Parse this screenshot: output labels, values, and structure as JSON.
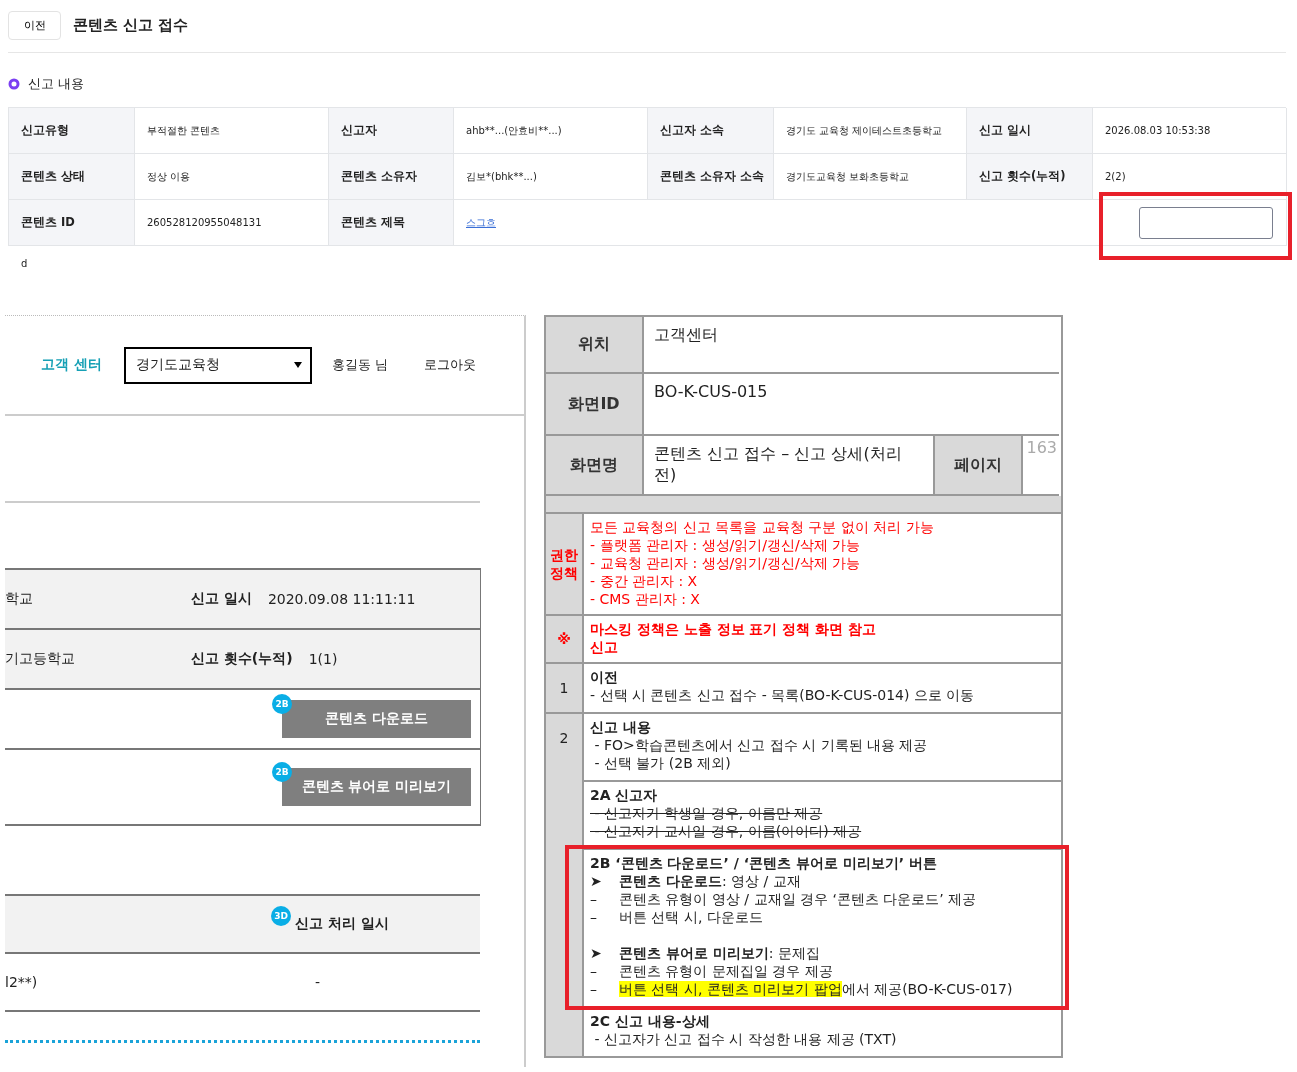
{
  "header": {
    "back_button": "이전",
    "title": "콘텐츠 신고 접수"
  },
  "section_title": "신고 내용",
  "report_table": {
    "rows": [
      [
        {
          "label": "신고유형",
          "value": "부적절한 콘텐츠"
        },
        {
          "label": "신고자",
          "value": "ahb**...(안효비**...)"
        },
        {
          "label": "신고자 소속",
          "value": "경기도 교육청 제이테스트초등학교"
        },
        {
          "label": "신고 일시",
          "value": "2026.08.03 10:53:38"
        }
      ],
      [
        {
          "label": "콘텐츠 상태",
          "value": "정상 이용"
        },
        {
          "label": "콘텐츠 소유자",
          "value": "김보*(bhk**...)"
        },
        {
          "label": "콘텐츠 소유자 소속",
          "value": "경기도교육청 보화초등학교"
        },
        {
          "label": "신고 횟수(누적)",
          "value": "2(2)"
        }
      ],
      [
        {
          "label": "콘텐츠 ID",
          "value": "260528120955048131"
        },
        {
          "label": "콘텐츠 제목",
          "value": "스그흐",
          "kind": "link"
        }
      ]
    ]
  },
  "note": "d",
  "preview_panel": {
    "header": {
      "menu": "고객 센터",
      "org_select": "경기도교육청",
      "user": "홍길동 님",
      "logout": "로그아웃"
    },
    "detail_rows": [
      {
        "kind": "info",
        "cell": "학교",
        "label": "신고 일시",
        "value": "2020.09.08 11:11:11"
      },
      {
        "kind": "info",
        "cell": "기고등학교",
        "label": "신고 횟수(누적)",
        "value": "1(1)"
      },
      {
        "kind": "button",
        "badge": "2B",
        "label": "콘텐츠 다운로드"
      },
      {
        "kind": "button",
        "badge": "2B",
        "label": "콘텐츠 뷰어로 미리보기"
      }
    ],
    "process_table": {
      "header": {
        "badge": "3D",
        "label": "신고 처리 일시"
      },
      "row": {
        "cell": "l2**)",
        "value": "-"
      }
    }
  },
  "spec": {
    "location_label": "위치",
    "location": "고객센터",
    "screen_id_label": "화면ID",
    "screen_id": "BO-K-CUS-015",
    "screen_name_label": "화면명",
    "screen_name": "콘텐츠 신고 접수 – 신고 상세(처리 전)",
    "page_label": "페이지",
    "page": "163",
    "rows": [
      {
        "label": "권한 정책",
        "kind": "policy",
        "lines": [
          {
            "text": "모든 교육청의 신고 목록을 교육청 구분 없이 처리 가능"
          },
          {
            "text": "- 플랫폼 관리자 : 생성/읽기/갱신/삭제 가능"
          },
          {
            "text": "- 교육청 관리자 : 생성/읽기/갱신/삭제 가능"
          },
          {
            "text": "- 중간 관리자 : X"
          },
          {
            "text": "- CMS 관리자 : X"
          }
        ]
      },
      {
        "label": "※",
        "kind": "notice",
        "lines": [
          {
            "text": "마스킹 정책은 노출 정보 표기 정책 화면 참고"
          },
          {
            "text": "신고"
          }
        ]
      },
      {
        "label": "1",
        "kind": "item",
        "sections": [
          {
            "title": "이전",
            "lines": [
              {
                "text": "- 선택 시 콘텐츠 신고 접수 - 목록(BO-K-CUS-014) 으로 이동"
              }
            ]
          }
        ]
      },
      {
        "label": "2",
        "kind": "item",
        "sections": [
          {
            "title": "신고 내용",
            "lines": [
              {
                "text": " - FO>학습콘텐츠에서 신고 접수 시 기록된 내용 제공"
              },
              {
                "text": " - 선택 불가 (2B 제외)"
              }
            ]
          },
          {
            "title": "2A 신고자",
            "lines": [
              {
                "text": " - 신고자가 학생일 경우, 이름만 제공",
                "struck": true
              },
              {
                "text": " - 신고자가 교사일 경우, 이름(아이디) 제공",
                "struck": true
              }
            ]
          },
          {
            "title": "2B ‘콘텐츠 다운로드’ / ‘콘텐츠 뷰어로 미리보기’ 버튼",
            "lines": [
              {
                "bullet": "➤",
                "segments": [
                  {
                    "text": "**콘텐츠 다운로드**: 영상 / 교재",
                    "highlighted": false
                  }
                ]
              },
              {
                "bullet": "–",
                "segments": [
                  {
                    "text": "콘텐츠 유형이 영상 / 교재일 경우 ‘콘텐츠 다운로드’ 제공",
                    "highlighted": false
                  }
                ]
              },
              {
                "bullet": "–",
                "segments": [
                  {
                    "text": "버튼 선택 시, 다운로드",
                    "highlighted": false
                  }
                ]
              },
              {
                "bullet": "➤",
                "spaced": true,
                "segments": [
                  {
                    "text": "**콘텐츠 뷰어로 미리보기**: 문제집",
                    "highlighted": false
                  }
                ]
              },
              {
                "bullet": "–",
                "segments": [
                  {
                    "text": "콘텐츠 유형이 문제집일 경우 제공",
                    "highlighted": false
                  }
                ]
              },
              {
                "bullet": "–",
                "segments": [
                  {
                    "text": "버튼 선택 시, 콘텐츠 미리보기 팝업",
                    "highlighted": true
                  },
                  {
                    "text": "에서 제공(BO-K-CUS-017)",
                    "highlighted": false
                  }
                ]
              }
            ]
          },
          {
            "title": "2C 신고 내용-상세",
            "lines": [
              {
                "text": " - 신고자가 신고 접수 시 작성한 내용 제공 (TXT)"
              }
            ]
          }
        ]
      }
    ]
  },
  "annotation_boxes": [
    {
      "kind": "frame"
    },
    {
      "kind": "frame"
    }
  ]
}
